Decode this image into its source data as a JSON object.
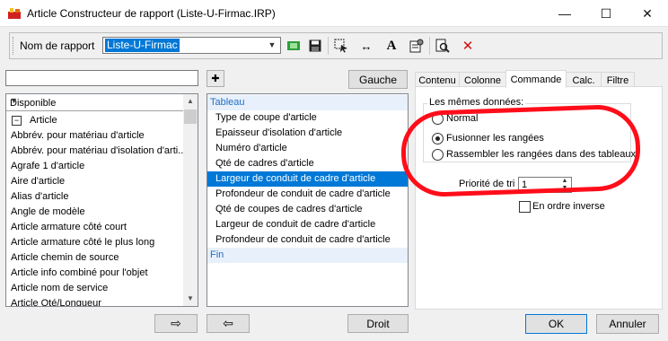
{
  "window": {
    "title": "Article Constructeur de rapport (Liste-U-Firmac.IRP)",
    "app_icon": "report-app-icon",
    "controls": {
      "minimize": "—",
      "maximize": "☐",
      "close": "✕"
    }
  },
  "toolbar": {
    "report_label": "Nom de rapport",
    "report_value": "Liste-U-Firmac",
    "icons": [
      "add-report-icon",
      "save-icon",
      "select-icon",
      "column-width-icon",
      "font-icon",
      "settings-icon",
      "preview-icon",
      "delete-icon"
    ],
    "glyphs": {
      "font": "A",
      "delete": "✕",
      "width": "↔",
      "save": "▣"
    }
  },
  "left": {
    "search_value": "",
    "plus_glyph": "✚",
    "gauche_label": "Gauche",
    "filter_label": "Disponible",
    "group_label": "Article",
    "group_toggle": "−",
    "items": [
      "Abbrév. pour matériau d'article",
      "Abbrév. pour matériau d'isolation d'arti...",
      "Agrafe 1 d'article",
      "Aire d'article",
      "Alias d'article",
      "Angle de modèle",
      "Article armature côté court",
      "Article armature côté le plus long",
      "Article chemin de source",
      "Article info combiné pour l'objet",
      "Article nom de service",
      "Article Qté/Longueur"
    ],
    "add_arrow": "⇨"
  },
  "middle": {
    "section_start": "Tableau",
    "section_end": "Fin",
    "items": [
      "Type de coupe d'article",
      "Epaisseur d'isolation d'article",
      "Numéro d'article",
      "Qté de cadres d'article",
      "Largeur de conduit de cadre d'article",
      "Profondeur de conduit de cadre d'article",
      "Qté de coupes de cadres d'article",
      "Largeur de conduit de cadre d'article",
      "Profondeur de conduit de cadre d'article"
    ],
    "selected_index": 4,
    "remove_arrow": "⇦",
    "droit_label": "Droit"
  },
  "right": {
    "tabs": [
      "Contenu",
      "Colonne",
      "Commande",
      "Calc.",
      "Filtre"
    ],
    "active_tab": "Commande",
    "group_title": "Les mêmes données:",
    "options": [
      "Normal",
      "Fusionner les rangées",
      "Rassembler les rangées dans des tableaux"
    ],
    "selected_option": "Fusionner les rangées",
    "sort_label": "Priorité de tri",
    "sort_value": "1",
    "reverse_label": "En ordre inverse",
    "reverse_checked": false
  },
  "footer": {
    "ok": "OK",
    "cancel": "Annuler"
  },
  "colors": {
    "accent": "#0078d7",
    "annotation": "#ff0d1a",
    "section_text": "#1f6fc1"
  }
}
